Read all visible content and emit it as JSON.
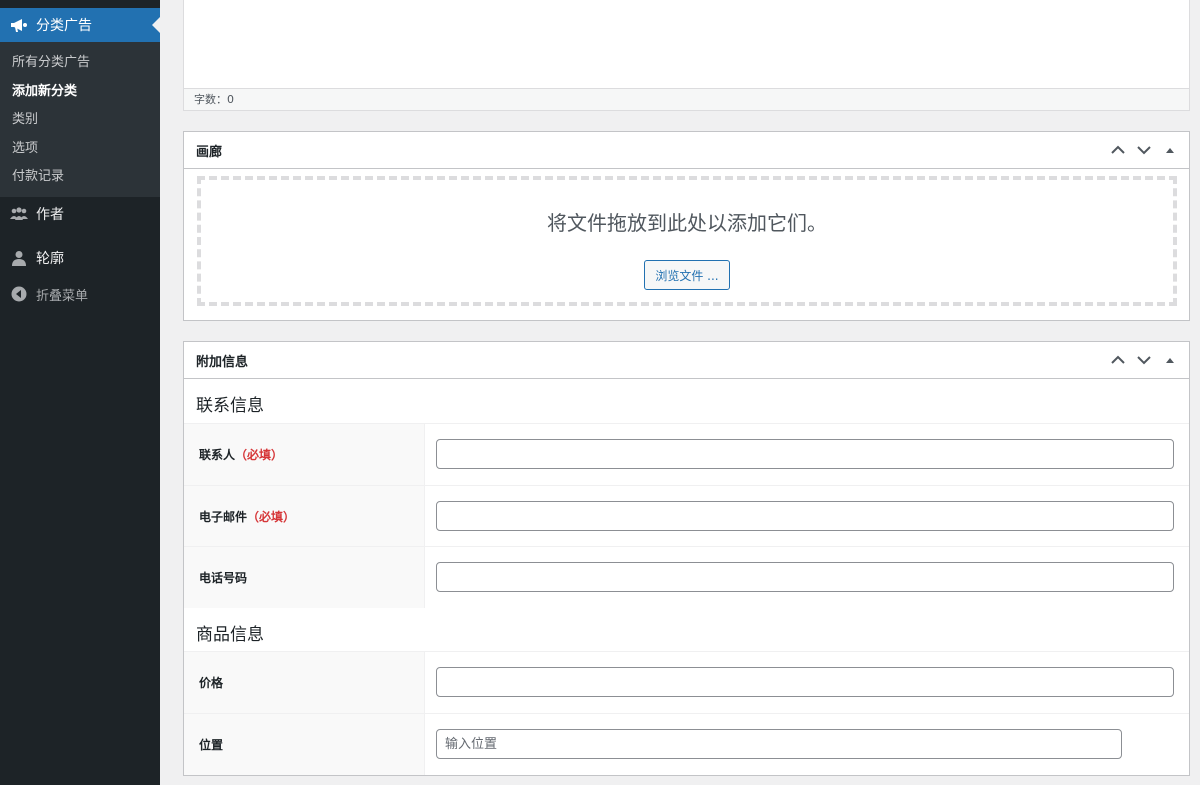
{
  "sidebar": {
    "current_menu": {
      "label": "分类广告",
      "icon": "megaphone-icon"
    },
    "submenu": [
      {
        "label": "所有分类广告",
        "current": false
      },
      {
        "label": "添加新分类",
        "current": true
      },
      {
        "label": "类别",
        "current": false
      },
      {
        "label": "选项",
        "current": false
      },
      {
        "label": "付款记录",
        "current": false
      }
    ],
    "items": [
      {
        "label": "作者",
        "icon": "users-icon"
      },
      {
        "label": "轮廓",
        "icon": "user-icon"
      },
      {
        "label": "折叠菜单",
        "icon": "collapse-icon"
      }
    ]
  },
  "editor": {
    "word_count": "字数：0"
  },
  "gallery": {
    "title": "画廊",
    "drop_text": "将文件拖放到此处以添加它们。",
    "browse_label": "浏览文件 ..."
  },
  "extra_info": {
    "title": "附加信息",
    "contact_section": "联系信息",
    "product_section": "商品信息",
    "fields": {
      "contact_name": {
        "label": "联系人",
        "required": "（必填）",
        "value": ""
      },
      "email": {
        "label": "电子邮件",
        "required": "（必填）",
        "value": ""
      },
      "phone": {
        "label": "电话号码",
        "value": ""
      },
      "price": {
        "label": "价格",
        "value": ""
      },
      "location": {
        "label": "位置",
        "value": "",
        "placeholder": "输入位置"
      }
    }
  },
  "colors": {
    "admin_bar_bg": "#1d2327",
    "submenu_bg": "#2c3338",
    "accent": "#2271b1",
    "required": "#d63638"
  }
}
